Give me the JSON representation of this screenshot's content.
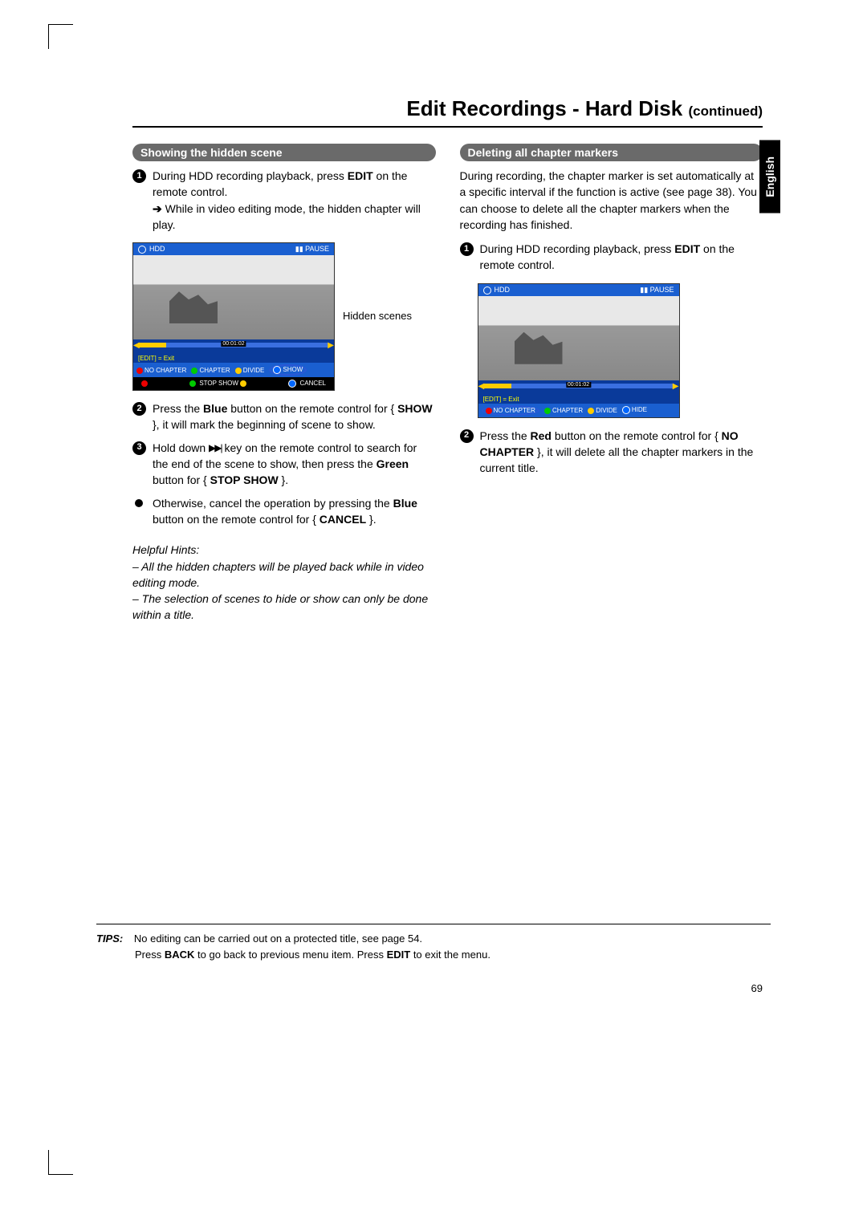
{
  "title_main": "Edit Recordings - Hard Disk",
  "title_cont": "(continued)",
  "language_tab": "English",
  "page_number": "69",
  "left": {
    "header": "Showing the hidden scene",
    "step1_a": "During HDD recording playback, press ",
    "step1_b": "EDIT",
    "step1_c": " on the remote control.",
    "step1_sub": " While in video editing mode, the hidden chapter will play.",
    "fig_caption": "Hidden scenes",
    "step2_a": "Press the ",
    "step2_b": "Blue",
    "step2_c": " button on the remote control for { ",
    "step2_d": "SHOW",
    "step2_e": " }, it will mark the beginning of scene to show.",
    "step3_a": "Hold down ",
    "step3_b": " key on the remote control to search for the end of the scene to show, then press the ",
    "step3_c": "Green",
    "step3_d": " button for { ",
    "step3_e": "STOP SHOW",
    "step3_f": " }.",
    "bullet_a": "Otherwise, cancel the operation by pressing the ",
    "bullet_b": "Blue",
    "bullet_c": " button on the remote control for { ",
    "bullet_d": "CANCEL",
    "bullet_e": " }.",
    "hints_title": "Helpful Hints:",
    "hints_1": "– All the hidden chapters will be played back while in video editing mode.",
    "hints_2": "– The selection of scenes to hide or show can only be done within a title."
  },
  "right": {
    "header": "Deleting all chapter markers",
    "intro": "During recording, the chapter marker is set automatically at a specific interval if the function is active (see page 38). You can choose to delete all the chapter markers when the recording has finished.",
    "step1_a": "During HDD recording playback, press ",
    "step1_b": "EDIT",
    "step1_c": " on the remote control.",
    "step2_a": "Press the ",
    "step2_b": "Red",
    "step2_c": " button on the remote control for { ",
    "step2_d": "NO CHAPTER",
    "step2_e": " }, it will delete all the chapter markers in the current title."
  },
  "fig": {
    "hdd": "HDD",
    "pause": "PAUSE",
    "time": "00:01:02",
    "exit": "[EDIT] = Exit",
    "btn_nochapter": "NO CHAPTER",
    "btn_chapter": "CHAPTER",
    "btn_divide": "DIVIDE",
    "btn_show": "SHOW",
    "btn_hide": "HIDE",
    "stop_show": "STOP SHOW",
    "cancel": "CANCEL"
  },
  "tips": {
    "label": "TIPS:",
    "line1": "No editing can be carried out on a protected title, see page 54.",
    "line2_a": "Press ",
    "line2_b": "BACK",
    "line2_c": " to go back to previous menu item. Press ",
    "line2_d": "EDIT",
    "line2_e": " to exit the menu."
  }
}
